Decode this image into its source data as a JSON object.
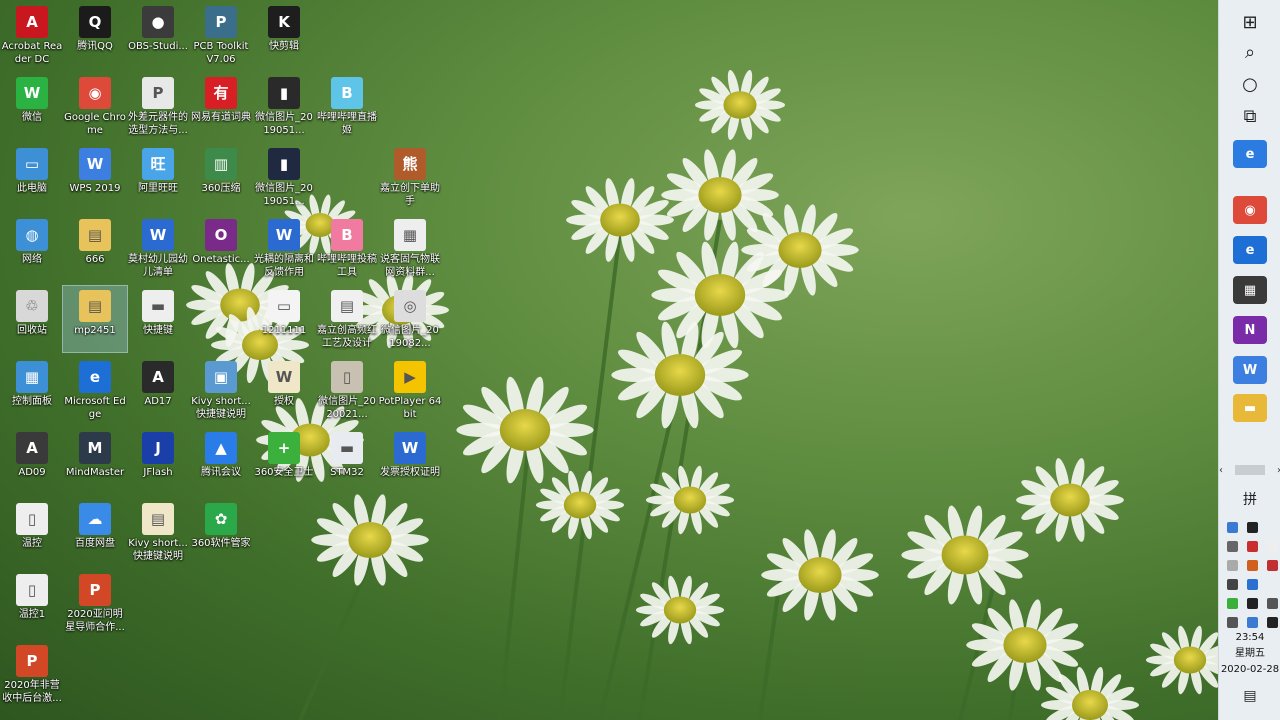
{
  "desktop": {
    "icons": [
      {
        "label": "Acrobat Reader DC",
        "icon": "acrobat-icon",
        "color": "#c8171e",
        "glyph": "A",
        "shortcut": false
      },
      {
        "label": "腾讯QQ",
        "icon": "qq-penguin-icon",
        "color": "#1b1b1b",
        "glyph": "Q",
        "shortcut": false
      },
      {
        "label": "OBS-Studi...",
        "icon": "obs-icon",
        "color": "#3b3b3b",
        "glyph": "●",
        "shortcut": false
      },
      {
        "label": "PCB Toolkit V7.06",
        "icon": "pcb-toolkit-icon",
        "color": "#3a6e8a",
        "glyph": "P",
        "shortcut": false
      },
      {
        "label": "快剪辑",
        "icon": "kuaijianji-icon",
        "color": "#1e1e1e",
        "glyph": "K",
        "shortcut": false
      },
      {
        "label": "微信",
        "icon": "wechat-icon",
        "color": "#2ab243",
        "glyph": "W",
        "shortcut": false
      },
      {
        "label": "Google Chrome",
        "icon": "chrome-icon",
        "color": "#dd4a3a",
        "glyph": "◉",
        "shortcut": false
      },
      {
        "label": "外差元器件的选型方法与...",
        "icon": "pdf-file-icon",
        "color": "#e8e8e8",
        "glyph": "P",
        "shortcut": true
      },
      {
        "label": "网易有道词典",
        "icon": "youdao-icon",
        "color": "#d81f26",
        "glyph": "有",
        "shortcut": false
      },
      {
        "label": "微信图片_2019051...",
        "icon": "image-file-icon",
        "color": "#2a2a2a",
        "glyph": "▮",
        "shortcut": false
      },
      {
        "label": "哔哩哔哩直播姬",
        "icon": "bilibili-live-icon",
        "color": "#5ec4e8",
        "glyph": "B",
        "shortcut": false
      },
      {
        "label": "此电脑",
        "icon": "this-pc-icon",
        "color": "#3d8fd6",
        "glyph": "▭",
        "shortcut": false
      },
      {
        "label": "WPS 2019",
        "icon": "wps-icon",
        "color": "#3c7fe0",
        "glyph": "W",
        "shortcut": false
      },
      {
        "label": "阿里旺旺",
        "icon": "aliwangwang-icon",
        "color": "#4aa4e8",
        "glyph": "旺",
        "shortcut": false
      },
      {
        "label": "360压缩",
        "icon": "360zip-icon",
        "color": "#3d8a4a",
        "glyph": "▥",
        "shortcut": false
      },
      {
        "label": "微信图片_2019051...",
        "icon": "image-file-icon",
        "color": "#1f2a40",
        "glyph": "▮",
        "shortcut": false
      },
      {
        "label": "嘉立创下单助手",
        "icon": "jlc-assistant-icon",
        "color": "#b05b2a",
        "glyph": "熊",
        "shortcut": false
      },
      {
        "label": "网络",
        "icon": "network-icon",
        "color": "#3d8fd6",
        "glyph": "◍",
        "shortcut": false
      },
      {
        "label": "666",
        "icon": "folder-icon",
        "color": "#e8c25a",
        "glyph": "▤",
        "shortcut": false
      },
      {
        "label": "莫村幼儿园幼儿清单",
        "icon": "word-file-icon",
        "color": "#2b6ad0",
        "glyph": "W",
        "shortcut": true
      },
      {
        "label": "Onetastic...",
        "icon": "onetastic-icon",
        "color": "#7a2b8a",
        "glyph": "O",
        "shortcut": false
      },
      {
        "label": "光耦的隔离和反馈作用",
        "icon": "word-file-icon",
        "color": "#2b6ad0",
        "glyph": "W",
        "shortcut": true
      },
      {
        "label": "哔哩哔哩投稿工具",
        "icon": "bilibili-upload-icon",
        "color": "#f07aa0",
        "glyph": "B",
        "shortcut": false
      },
      {
        "label": "说客固气物联网资料群...",
        "icon": "qrcode-image-icon",
        "color": "#eeeeee",
        "glyph": "▦",
        "shortcut": false
      },
      {
        "label": "回收站",
        "icon": "recycle-bin-icon",
        "color": "#d8d8d8",
        "glyph": "♲",
        "shortcut": false
      },
      {
        "label": "mp2451",
        "icon": "folder-icon",
        "color": "#e8c25a",
        "glyph": "▤",
        "shortcut": false
      },
      {
        "label": "快捷键",
        "icon": "image-file-icon",
        "color": "#eeeeee",
        "glyph": "▬",
        "shortcut": false
      },
      {
        "label": "1211111",
        "icon": "image-file-icon",
        "color": "#f4f4f4",
        "glyph": "▭",
        "shortcut": false
      },
      {
        "label": "嘉立创高频红工艺及设计规...",
        "icon": "document-file-icon",
        "color": "#f0f0f0",
        "glyph": "▤",
        "shortcut": true
      },
      {
        "label": "微信图片_2019082...",
        "icon": "image-file-icon",
        "color": "#dddddd",
        "glyph": "◎",
        "shortcut": false
      },
      {
        "label": "控制面板",
        "icon": "control-panel-icon",
        "color": "#3d8fd6",
        "glyph": "▦",
        "shortcut": false
      },
      {
        "label": "Microsoft Edge",
        "icon": "edge-icon",
        "color": "#1d6fd6",
        "glyph": "e",
        "shortcut": false
      },
      {
        "label": "AD17",
        "icon": "altium-icon",
        "color": "#2a2a2a",
        "glyph": "A",
        "shortcut": true
      },
      {
        "label": "Kivy short...快捷键说明",
        "icon": "image-file-icon",
        "color": "#5a9ad0",
        "glyph": "▣",
        "shortcut": false
      },
      {
        "label": "授权",
        "icon": "document-file-icon",
        "color": "#f0e6c8",
        "glyph": "W",
        "shortcut": true
      },
      {
        "label": "微信图片_2020021...",
        "icon": "image-file-icon",
        "color": "#c8c0b0",
        "glyph": "▯",
        "shortcut": false
      },
      {
        "label": "PotPlayer 64 bit",
        "icon": "potplayer-icon",
        "color": "#f5c400",
        "glyph": "▶",
        "shortcut": false
      },
      {
        "label": "AD09",
        "icon": "altium-icon",
        "color": "#3a3a3a",
        "glyph": "A",
        "shortcut": false
      },
      {
        "label": "MindMaster",
        "icon": "mindmaster-icon",
        "color": "#2d3a4a",
        "glyph": "M",
        "shortcut": false
      },
      {
        "label": "JFlash",
        "icon": "jflash-icon",
        "color": "#1a3fa8",
        "glyph": "J",
        "shortcut": false
      },
      {
        "label": "腾讯会议",
        "icon": "tencent-meeting-icon",
        "color": "#2a7de8",
        "glyph": "▲",
        "shortcut": false
      },
      {
        "label": "360安全卫士",
        "icon": "360safe-icon",
        "color": "#3cb03c",
        "glyph": "+",
        "shortcut": false
      },
      {
        "label": "STM32",
        "icon": "image-file-icon",
        "color": "#e8ecf0",
        "glyph": "▬",
        "shortcut": false
      },
      {
        "label": "发票授权证明",
        "icon": "word-file-icon",
        "color": "#2b6ad0",
        "glyph": "W",
        "shortcut": true
      },
      {
        "label": "温控",
        "icon": "image-file-icon",
        "color": "#eeeeee",
        "glyph": "▯",
        "shortcut": false
      },
      {
        "label": "百度网盘",
        "icon": "baidu-netdisk-icon",
        "color": "#3a8be8",
        "glyph": "☁",
        "shortcut": false
      },
      {
        "label": "Kivy short...快捷键说明",
        "icon": "document-file-icon",
        "color": "#f0e6c8",
        "glyph": "▤",
        "shortcut": true
      },
      {
        "label": "360软件管家",
        "icon": "360software-icon",
        "color": "#2aa84a",
        "glyph": "✿",
        "shortcut": false
      },
      {
        "label": "温控1",
        "icon": "image-file-icon",
        "color": "#eeeeee",
        "glyph": "▯",
        "shortcut": false
      },
      {
        "label": "2020亚问明星导师合作...",
        "icon": "powerpoint-file-icon",
        "color": "#d24726",
        "glyph": "P",
        "shortcut": false
      },
      {
        "label": "2020年非营收中后台激...",
        "icon": "powerpoint-file-icon",
        "color": "#d24726",
        "glyph": "P",
        "shortcut": false
      }
    ]
  },
  "taskbar": {
    "system_buttons": [
      {
        "name": "start-button",
        "icon": "windows-logo-icon",
        "glyph": "⊞"
      },
      {
        "name": "search-button",
        "icon": "search-icon",
        "glyph": "⌕"
      },
      {
        "name": "cortana-button",
        "icon": "cortana-circle-icon",
        "glyph": "○"
      },
      {
        "name": "task-view-button",
        "icon": "task-view-icon",
        "glyph": "⧉"
      }
    ],
    "pinned_apps": [
      {
        "name": "ie",
        "icon": "internet-explorer-icon",
        "color": "#2b7be0",
        "glyph": "e"
      },
      {
        "name": "chrome",
        "icon": "chrome-icon",
        "color": "#dd4a3a",
        "glyph": "◉"
      },
      {
        "name": "edge",
        "icon": "edge-icon",
        "color": "#1d6fd6",
        "glyph": "e"
      },
      {
        "name": "calculator",
        "icon": "calculator-icon",
        "color": "#3a3a3a",
        "glyph": "▦"
      },
      {
        "name": "onenote",
        "icon": "onenote-icon",
        "color": "#7a2ba8",
        "glyph": "N"
      },
      {
        "name": "wps",
        "icon": "wps-icon",
        "color": "#3c7fe0",
        "glyph": "W"
      },
      {
        "name": "explorer",
        "icon": "file-explorer-icon",
        "color": "#e8b838",
        "glyph": "▬"
      }
    ],
    "tray_icons": [
      [
        "input-method-icon",
        "keyboard-icon"
      ],
      [
        "tray-app-icon",
        "microphone-icon",
        "clipboard-icon"
      ],
      [
        "qq-tray-icon",
        "wechat-tray-icon",
        "battery-tray-icon"
      ],
      [
        "search-tray-icon",
        "shield-tray-icon"
      ],
      [
        "pc-tray-icon",
        "defender-tray-icon",
        "360-tray-icon"
      ],
      [
        "battery-icon",
        "wifi-icon",
        "volume-icon"
      ]
    ],
    "clock": {
      "time": "23:54",
      "weekday": "星期五",
      "date": "2020-02-28"
    },
    "notification_icon": "action-center-icon"
  }
}
